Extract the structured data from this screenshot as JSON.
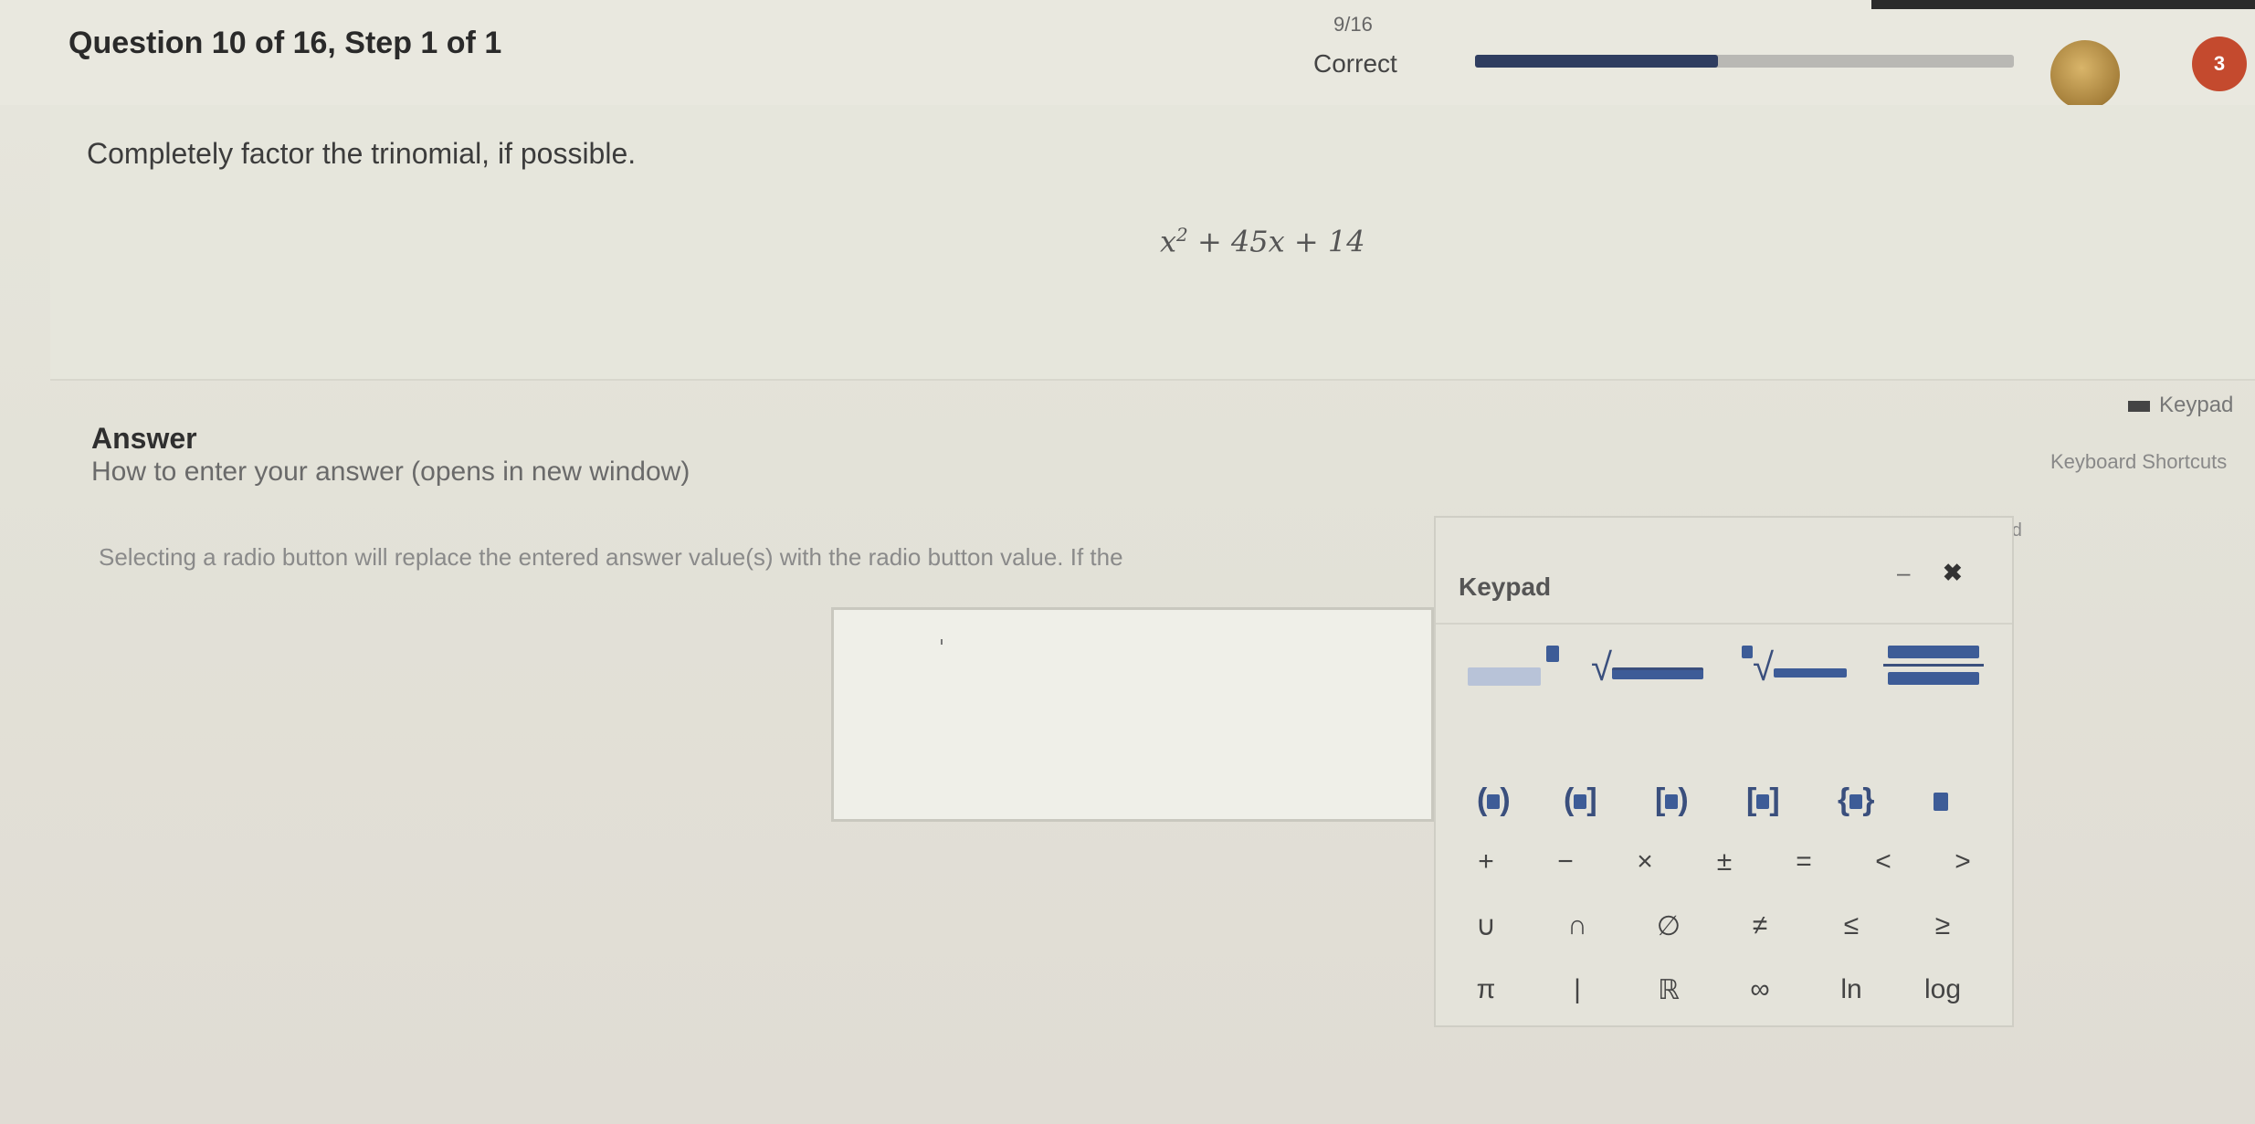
{
  "header": {
    "question_title": "Question 10 of 16, Step 1 of 1",
    "score": "9/16",
    "status": "Correct",
    "progress_fraction": 0.45,
    "badge_count": "3"
  },
  "question": {
    "prompt": "Completely factor the trinomial, if possible.",
    "expression_base": "x",
    "expression_exp": "2",
    "expression_rest": " + 45x + 14"
  },
  "answer": {
    "label": "Answer",
    "how_to_link": "How to enter your answer (opens in new window)",
    "keypad_toggle": "Keypad",
    "keyboard_shortcuts": "Keyboard Shortcuts",
    "used_text": "s used",
    "instruction": "Selecting a radio button will replace the entered answer value(s) with the radio button value. If the"
  },
  "keypad": {
    "title": "Keypad",
    "minimize": "–",
    "close": "✖",
    "operators": [
      "+",
      "−",
      "×",
      "±",
      "=",
      "<",
      ">"
    ],
    "relations": [
      "∪",
      "∩",
      "∅",
      "≠",
      "≤",
      "≥"
    ],
    "constants": [
      "π",
      "|",
      "ℝ",
      "∞",
      "ln",
      "log"
    ]
  },
  "colors": {
    "accent": "#2f3d60",
    "slot": "#3d5c97",
    "badge": "#c44a2e"
  }
}
